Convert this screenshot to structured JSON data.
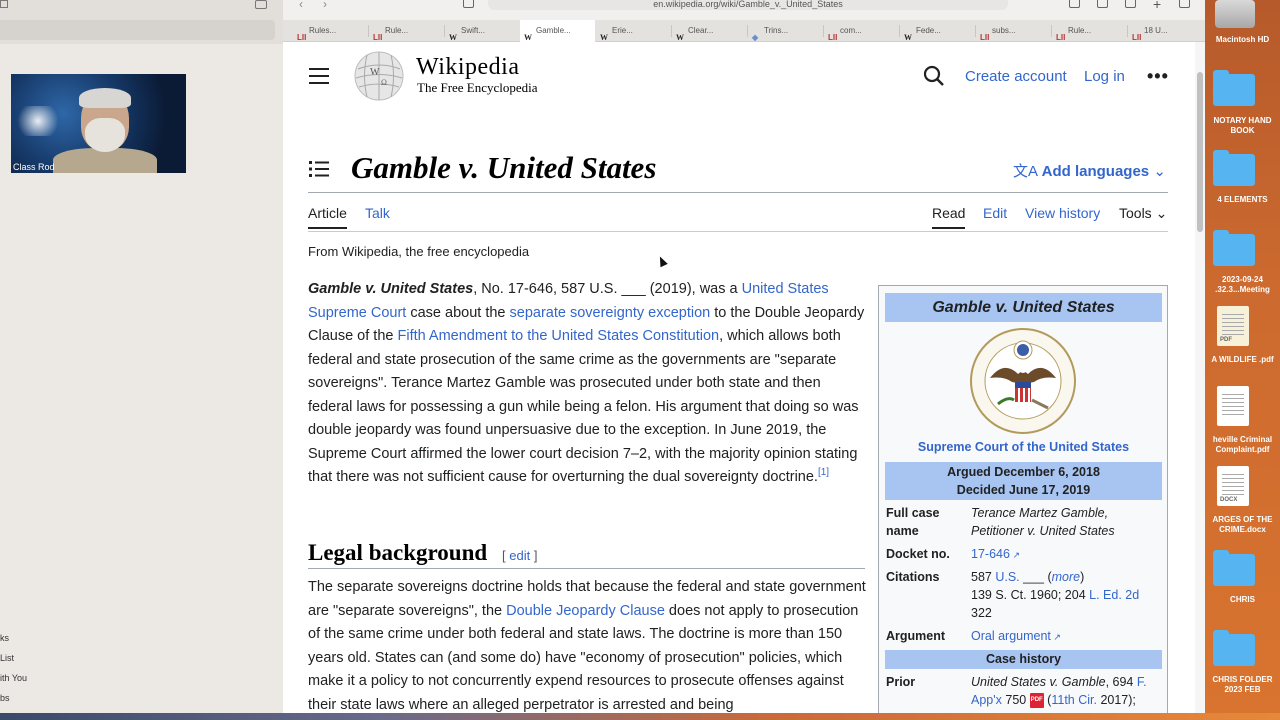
{
  "video_call": {
    "participant_name": "Class Rod"
  },
  "left_sidebar_items": [
    "ks",
    "List",
    "ith You",
    "bs"
  ],
  "browser": {
    "url": "en.wikipedia.org/wiki/Gamble_v._United_States",
    "tabs": [
      {
        "favicon": "LII",
        "label": "Rules..."
      },
      {
        "favicon": "LII",
        "label": "Rule..."
      },
      {
        "favicon": "W",
        "label": "Swift..."
      },
      {
        "favicon": "W",
        "label": "Gamble...",
        "active": true
      },
      {
        "favicon": "W",
        "label": "Erie..."
      },
      {
        "favicon": "W",
        "label": "Clear..."
      },
      {
        "favicon": "◆",
        "label": "Trins..."
      },
      {
        "favicon": "LII",
        "label": "com..."
      },
      {
        "favicon": "W",
        "label": "Fede..."
      },
      {
        "favicon": "LII",
        "label": "subs..."
      },
      {
        "favicon": "LII",
        "label": "Rule..."
      },
      {
        "favicon": "LII",
        "label": "18 U..."
      }
    ]
  },
  "wiki": {
    "wordmark": "Wikipedia",
    "tagline": "The Free Encyclopedia",
    "create_account": "Create account",
    "log_in": "Log in",
    "title": "Gamble v. United States",
    "add_languages": "Add languages",
    "tab_article": "Article",
    "tab_talk": "Talk",
    "tab_read": "Read",
    "tab_edit": "Edit",
    "tab_history": "View history",
    "tab_tools": "Tools",
    "from": "From Wikipedia, the free encyclopedia",
    "lead": {
      "bold_title": "Gamble v. United States",
      "t1": ", No. 17-646, 587 U.S. ___ (2019), was a ",
      "l1": "United States Supreme Court",
      "t2": " case about the ",
      "l2": "separate sovereignty exception",
      "t3": " to the Double Jeopardy Clause of the ",
      "l3": "Fifth Amendment to the United States Constitution",
      "t4": ", which allows both federal and state prosecution of the same crime as the governments are \"separate sovereigns\". Terance Martez Gamble was prosecuted under both state and then federal laws for possessing a gun while being a felon. His argument that doing so was double jeopardy was found unpersuasive due to the exception. In June 2019, the Supreme Court affirmed the lower court decision 7–2, with the majority opinion stating that there was not sufficient cause for overturning the dual sovereignty doctrine.",
      "ref": "[1]"
    },
    "section_heading": "Legal background",
    "section_edit": "edit",
    "section_para": {
      "t1": "The separate sovereigns doctrine holds that because the federal and state government are \"separate sovereigns\", the ",
      "l1": "Double Jeopardy Clause",
      "t2": " does not apply to prosecution of the same crime under both federal and state laws. The doctrine is more than 150 years old. States can (and some do) have \"economy of prosecution\" policies, which make it a policy to not concurrently expend resources to prosecute offenses against their state laws where an alleged perpetrator is arrested and being"
    },
    "infobox": {
      "title": "Gamble v. United States",
      "court": "Supreme Court of the United States",
      "argued": "Argued December 6, 2018",
      "decided": "Decided June 17, 2019",
      "full_case_label": "Full case name",
      "full_case_value": "Terance Martez Gamble, Petitioner v. United States",
      "docket_label": "Docket no.",
      "docket_value": "17-646",
      "citations_label": "Citations",
      "cit_a": "587 ",
      "cit_us": "U.S.",
      "cit_b": " ___ (",
      "cit_more": "more",
      "cit_c": ")",
      "cit_line2": "139 S. Ct. 1960; 204 ",
      "cit_led": "L. Ed. 2d",
      "cit_line3": "322",
      "argument_label": "Argument",
      "argument_value": "Oral argument",
      "case_history": "Case history",
      "prior_label": "Prior",
      "prior_a": "United States v. Gamble",
      "prior_b": ", 694 ",
      "prior_f": "F. App'x",
      "prior_c": " 750 ",
      "prior_cir": "11th Cir.",
      "prior_d": " 2017);"
    }
  },
  "desktop_items": [
    {
      "label": "Macintosh HD",
      "kind": "disk"
    },
    {
      "label": "NOTARY HAND BOOK",
      "kind": "folder"
    },
    {
      "label": "4 ELEMENTS",
      "kind": "folder"
    },
    {
      "label": "2023-09-24 .32.3...Meeting",
      "kind": "folder"
    },
    {
      "label": "A WILDLIFE .pdf",
      "kind": "pdf"
    },
    {
      "label": "heville Criminal Complaint.pdf",
      "kind": "doc"
    },
    {
      "label": "ARGES OF THE CRIME.docx",
      "kind": "docx"
    },
    {
      "label": "CHRIS",
      "kind": "folder"
    },
    {
      "label": "CHRIS FOLDER 2023 FEB",
      "kind": "folder"
    }
  ]
}
